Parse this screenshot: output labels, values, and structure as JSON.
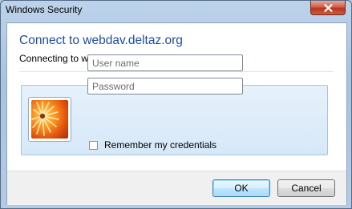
{
  "window": {
    "title": "Windows Security",
    "close_icon": "close-icon"
  },
  "dialog": {
    "heading": "Connect to webdav.deltaz.org",
    "subheading": "Connecting to webdav.deltaz.org"
  },
  "credentials": {
    "avatar_icon": "user-tile-flower-icon",
    "username": {
      "value": "",
      "placeholder": "User name"
    },
    "password": {
      "value": "",
      "placeholder": "Password"
    },
    "remember": {
      "label": "Remember my credentials",
      "checked": false
    }
  },
  "buttons": {
    "ok_label": "OK",
    "cancel_label": "Cancel"
  },
  "colors": {
    "heading": "#1f4d9c",
    "panel": "#d6e8f8",
    "titlebar": "#bcd3ea",
    "close": "#c94a30"
  }
}
